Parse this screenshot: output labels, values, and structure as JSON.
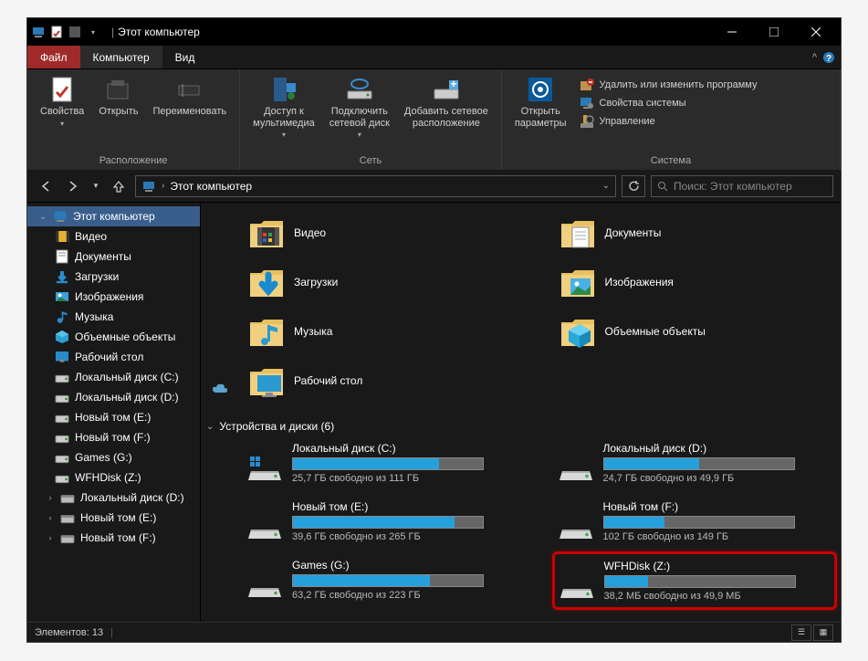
{
  "title": "Этот компьютер",
  "menubar": {
    "file": "Файл",
    "computer": "Компьютер",
    "view": "Вид"
  },
  "ribbon": {
    "group_location": {
      "label": "Расположение",
      "properties": "Свойства",
      "open": "Открыть",
      "rename": "Переименовать"
    },
    "group_network": {
      "label": "Сеть",
      "media": "Доступ к\nмультимедиа",
      "netdrive": "Подключить\nсетевой диск",
      "netplace": "Добавить сетевое\nрасположение"
    },
    "group_system": {
      "label": "Система",
      "open_settings": "Открыть\nпараметры",
      "uninstall": "Удалить или изменить программу",
      "sysprops": "Свойства системы",
      "manage": "Управление"
    }
  },
  "breadcrumb": "Этот компьютер",
  "search_placeholder": "Поиск: Этот компьютер",
  "tree": [
    {
      "label": "Этот компьютер",
      "icon": "pc",
      "selected": true,
      "indent": 0
    },
    {
      "label": "Видео",
      "icon": "video",
      "indent": 1
    },
    {
      "label": "Документы",
      "icon": "docs",
      "indent": 1
    },
    {
      "label": "Загрузки",
      "icon": "downloads",
      "indent": 1
    },
    {
      "label": "Изображения",
      "icon": "images",
      "indent": 1
    },
    {
      "label": "Музыка",
      "icon": "music",
      "indent": 1
    },
    {
      "label": "Объемные объекты",
      "icon": "3d",
      "indent": 1
    },
    {
      "label": "Рабочий стол",
      "icon": "desktop",
      "indent": 1
    },
    {
      "label": "Локальный диск (C:)",
      "icon": "drive",
      "indent": 1
    },
    {
      "label": "Локальный диск (D:)",
      "icon": "drive",
      "indent": 1
    },
    {
      "label": "Новый том (E:)",
      "icon": "drive",
      "indent": 1
    },
    {
      "label": "Новый том (F:)",
      "icon": "drive",
      "indent": 1
    },
    {
      "label": "Games (G:)",
      "icon": "drive",
      "indent": 1
    },
    {
      "label": "WFHDisk (Z:)",
      "icon": "drive",
      "indent": 1
    },
    {
      "label": "Локальный диск (D:)",
      "icon": "removable",
      "indent": 0
    },
    {
      "label": "Новый том (E:)",
      "icon": "removable",
      "indent": 0
    },
    {
      "label": "Новый том (F:)",
      "icon": "removable",
      "indent": 0
    }
  ],
  "folders": [
    {
      "label": "Видео",
      "icon": "video"
    },
    {
      "label": "Документы",
      "icon": "docs"
    },
    {
      "label": "Загрузки",
      "icon": "downloads"
    },
    {
      "label": "Изображения",
      "icon": "images"
    },
    {
      "label": "Музыка",
      "icon": "music"
    },
    {
      "label": "Объемные объекты",
      "icon": "3d"
    },
    {
      "label": "Рабочий стол",
      "icon": "desktop"
    }
  ],
  "drives_header": "Устройства и диски (6)",
  "drives": [
    {
      "label": "Локальный диск (C:)",
      "sub": "25,7 ГБ свободно из 111 ГБ",
      "fill": 77,
      "os": true
    },
    {
      "label": "Локальный диск (D:)",
      "sub": "24,7 ГБ свободно из 49,9 ГБ",
      "fill": 50
    },
    {
      "label": "Новый том (E:)",
      "sub": "39,6 ГБ свободно из 265 ГБ",
      "fill": 85
    },
    {
      "label": "Новый том (F:)",
      "sub": "102 ГБ свободно из 149 ГБ",
      "fill": 32
    },
    {
      "label": "Games (G:)",
      "sub": "63,2 ГБ свободно из 223 ГБ",
      "fill": 72
    },
    {
      "label": "WFHDisk (Z:)",
      "sub": "38,2 МБ свободно из 49,9 МБ",
      "fill": 23,
      "highlight": true
    }
  ],
  "status": {
    "items_label": "Элементов:",
    "count": "13"
  }
}
